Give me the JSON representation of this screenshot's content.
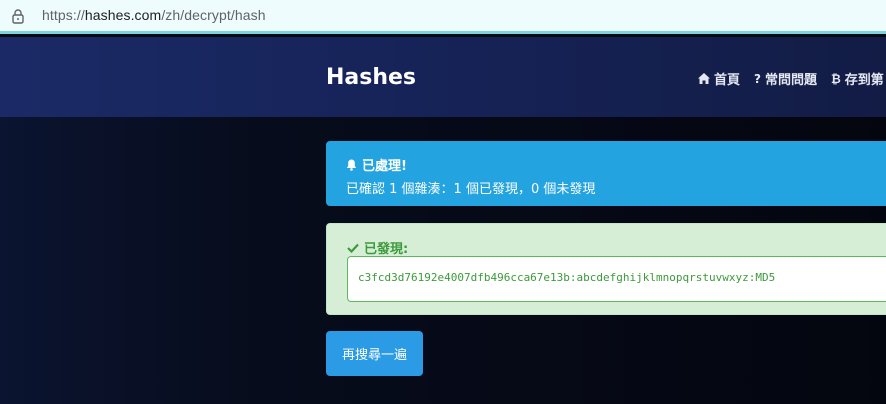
{
  "browser": {
    "url_prefix": "https://",
    "url_host": "hashes.com",
    "url_path": "/zh/decrypt/hash"
  },
  "navbar": {
    "brand": "Hashes",
    "links": [
      {
        "label": "首頁",
        "icon": "home-icon"
      },
      {
        "label": "常問問題",
        "icon": "question-icon"
      },
      {
        "label": "存到第",
        "icon": "bitcoin-icon"
      }
    ]
  },
  "info_alert": {
    "title": "已處理!",
    "message": "已確認 1 個雜湊：1 個已發現，0 個未發現",
    "icon": "bell-icon"
  },
  "success_alert": {
    "title": "已發現:",
    "icon": "check-icon",
    "result": "c3fcd3d76192e4007dfb496cca67e13b:abcdefghijklmnopqrstuvwxyz:MD5"
  },
  "search_again_label": "再搜尋一遍",
  "colors": {
    "info": "#23a3e0",
    "success_bg": "#d6eed6",
    "success_text": "#3c9a3c",
    "button": "#2b9be6"
  }
}
